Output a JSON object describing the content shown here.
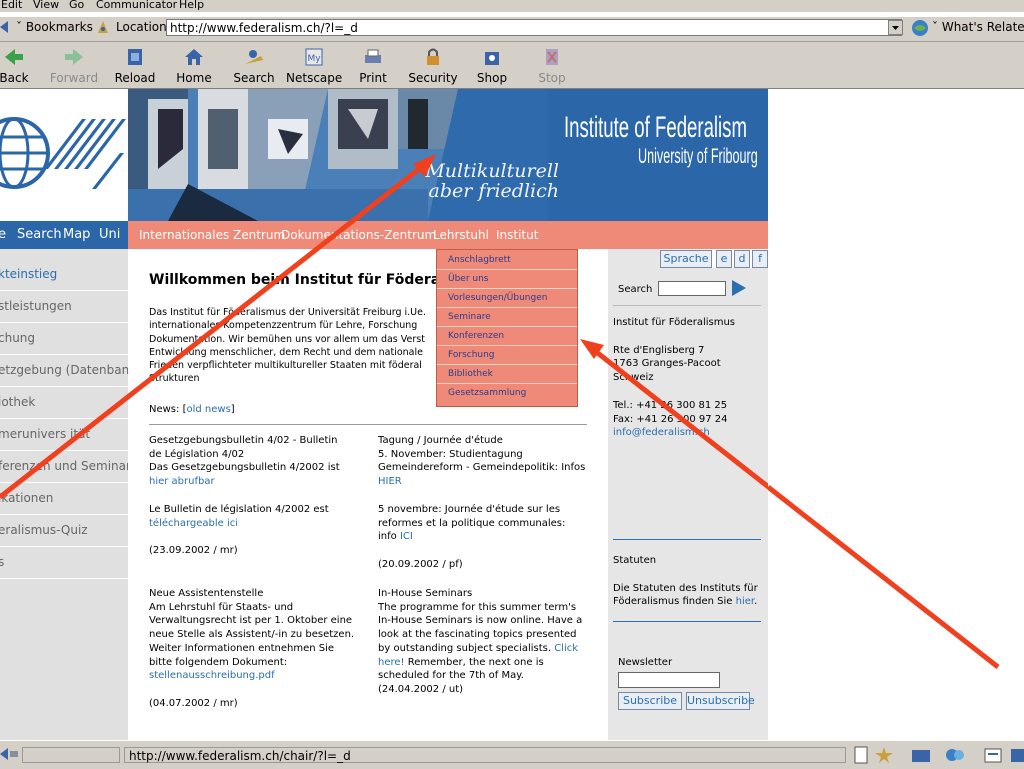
{
  "colors": {
    "accent_blue": "#2a6fb0",
    "banner_blue": "#2a66a8",
    "nav_salmon": "#f08a78",
    "arrow_red": "#f0401e"
  },
  "browser": {
    "menu": [
      "Edit",
      "View",
      "Go",
      "Communicator",
      "Help"
    ],
    "bookmarks_label": "Bookmarks",
    "location_label": "Location:",
    "url": "http://www.federalism.ch/?l=_d",
    "whats_related": "What's Related",
    "toolbar": [
      {
        "label": "Back",
        "icon": "back-arrow-icon",
        "disabled": false
      },
      {
        "label": "Forward",
        "icon": "forward-arrow-icon",
        "disabled": true
      },
      {
        "label": "Reload",
        "icon": "reload-icon",
        "disabled": false
      },
      {
        "label": "Home",
        "icon": "home-icon",
        "disabled": false
      },
      {
        "label": "Search",
        "icon": "search-icon",
        "disabled": false
      },
      {
        "label": "Netscape",
        "icon": "netscape-icon",
        "disabled": false
      },
      {
        "label": "Print",
        "icon": "print-icon",
        "disabled": false
      },
      {
        "label": "Security",
        "icon": "lock-icon",
        "disabled": false
      },
      {
        "label": "Shop",
        "icon": "shop-icon",
        "disabled": false
      },
      {
        "label": "Stop",
        "icon": "stop-icon",
        "disabled": true
      }
    ],
    "status_url": "http://www.federalism.ch/chair/?l=_d"
  },
  "banner": {
    "title": "Institute of Federalism",
    "subtitle": "University of Fribourg",
    "slogan1": "Multikulturell",
    "slogan2": "aber friedlich"
  },
  "topnav": {
    "left_links": [
      "e",
      "Search",
      "Map",
      "Uni"
    ],
    "main_links": [
      "Internationales Zentrum",
      "Dokumentations-Zentrum",
      "Lehrstuhl",
      "Institut"
    ]
  },
  "dropdown": [
    "Anschlagbrett",
    "Über uns",
    "Vorlesungen/Übungen",
    "Seminare",
    "Konferenzen",
    "Forschung",
    "Bibliothek",
    "Gesetzsammlung"
  ],
  "leftnav": [
    "kteinstieg",
    "stleistungen",
    "chung",
    "etzgebung (Datenbank)",
    "iothek",
    "merunivers ität",
    "ferenzen und Seminare",
    "ikationen",
    "eralismus-Quiz",
    "s"
  ],
  "content": {
    "heading": "Willkommen beim Institut für Föderalis",
    "intro": [
      "Das Institut für Föderalismus der Universität Freiburg i.Ue.",
      "internationales Kompetenzzentrum für Lehre, Forschung",
      "Dokumentation. Wir bemühen uns vor allem um das Verst",
      "Entwicklung menschlicher, dem Recht und dem nationale",
      "Frieden verpflichteter multikultureller Staaten mit föderal",
      "Strukturen"
    ],
    "news_label": "News: [",
    "old_news": "old news",
    "news_close": "]",
    "col1": {
      "item1": [
        "Gesetzgebungsbulletin 4/02 - Bulletin",
        "de Législation 4/02",
        "Das Gesetzgebungsbulletin 4/2002 ist"
      ],
      "item1_link": "hier abrufbar",
      "item1b": "Le Bulletin de législation 4/2002 est",
      "item1b_link": "téléchargeable ici",
      "item1_date": "(23.09.2002 / mr)",
      "item2": [
        "Neue Assistentenstelle",
        "Am Lehrstuhl für Staats- und",
        "Verwaltungsrecht ist per 1. Oktober eine",
        "neue Stelle als Assistent/-in zu besetzen.",
        "Weiter Informationen entnehmen Sie",
        "bitte folgendem Dokument:"
      ],
      "item2_link": "stellenausschreibung.pdf",
      "item2_date": "(04.07.2002 / mr)"
    },
    "col2": {
      "item1": [
        "Tagung / Journée d'étude",
        "5. November: Studientagung",
        "Gemeindereform - Gemeindepolitik: Infos"
      ],
      "item1_link": "HIER",
      "item1b": [
        "5 novembre: Journée d'étude sur les",
        "reformes et la politique communales:",
        "info "
      ],
      "item1b_link": "ICI",
      "item1_date": "(20.09.2002 / pf)",
      "item2": [
        "In-House Seminars",
        "The programme for this summer term's",
        "In-House Seminars is now online. Have a",
        "look at the fascinating topics presented",
        "by outstanding subject specialists. "
      ],
      "item2_link": "Click",
      "item2_link2": "here!",
      "item2_rest": [
        " Remember, the next one is",
        "scheduled for the 7th of May."
      ],
      "item2_date": "(24.04.2002 / ut)"
    }
  },
  "rightcol": {
    "lang": [
      "Sprache",
      "e",
      "d",
      "f"
    ],
    "search_label": "Search",
    "address": [
      "Institut für Föderalismus",
      "Rte d'Englisberg 7",
      "1763 Granges-Pacoot",
      "Schweiz"
    ],
    "tel": "Tel.: +41 26 300 81 25",
    "fax": "Fax: +41 26 300 97 24",
    "email": "info@federalism.ch",
    "statuten_title": "Statuten",
    "statuten_text": [
      "Die Statuten des Instituts für",
      "Föderalismus finden Sie "
    ],
    "statuten_link": "hier",
    "statuten_end": ".",
    "newsletter_label": "Newsletter",
    "subscribe": "Subscribe",
    "unsubscribe": "Unsubscribe"
  }
}
